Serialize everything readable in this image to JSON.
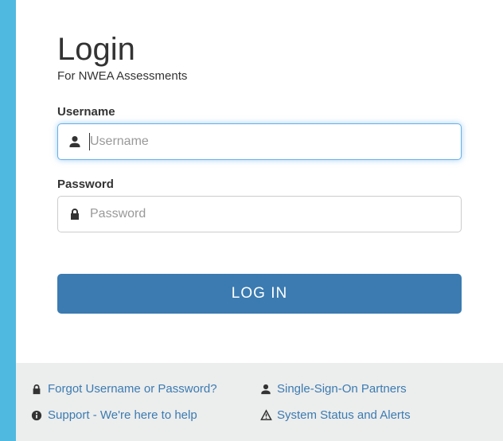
{
  "header": {
    "title": "Login",
    "subtitle": "For NWEA Assessments"
  },
  "form": {
    "username": {
      "label": "Username",
      "placeholder": "Username",
      "value": ""
    },
    "password": {
      "label": "Password",
      "placeholder": "Password",
      "value": ""
    },
    "login_button": "LOG IN"
  },
  "footer": {
    "forgot": "Forgot Username or Password?",
    "sso": "Single-Sign-On Partners",
    "support": "Support - We're here to help",
    "status": "System Status and Alerts"
  },
  "colors": {
    "primary": "#3b7bb1",
    "focus": "#66afe9",
    "background": "#4fb9e0"
  }
}
